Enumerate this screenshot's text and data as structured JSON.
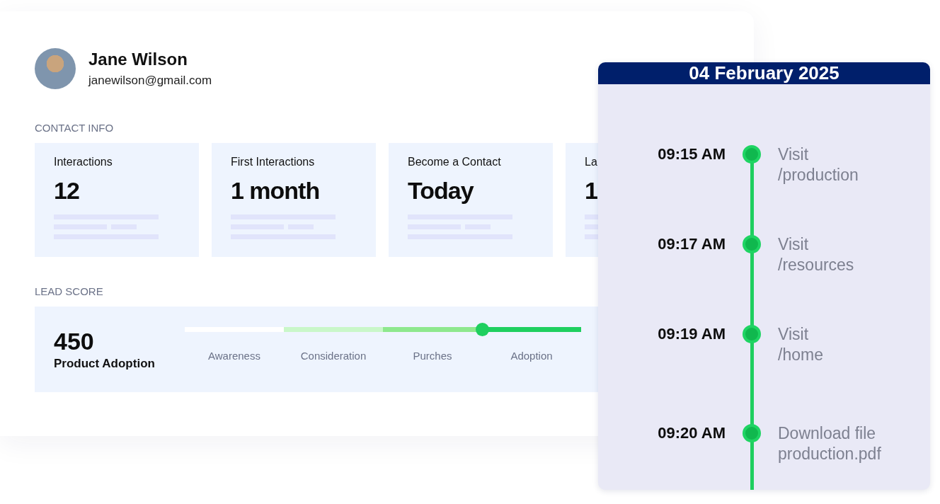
{
  "profile": {
    "name": "Jane Wilson",
    "email": "janewilson@gmail.com"
  },
  "contact_info": {
    "heading": "CONTACT INFO",
    "cards": [
      {
        "label": "Interactions",
        "value": "12"
      },
      {
        "label": "First Interactions",
        "value": "1 month"
      },
      {
        "label": "Become a Contact",
        "value": "Today"
      },
      {
        "label": "La",
        "value": "1"
      }
    ]
  },
  "lead_score": {
    "heading": "LEAD SCORE",
    "score": "450",
    "stage_name": "Product Adoption",
    "stages": [
      {
        "label": "Awareness",
        "color": "#ffffff",
        "selected": false
      },
      {
        "label": "Consideration",
        "color": "#c9f7c9",
        "selected": false
      },
      {
        "label": "Purches",
        "color": "#8ee88e",
        "selected": false
      },
      {
        "label": "Adoption",
        "color": "#1fcf5f",
        "selected": true
      }
    ]
  },
  "timeline": {
    "date": "04 February 2025",
    "events": [
      {
        "time": "09:15 AM",
        "action": "Visit",
        "target": "/production"
      },
      {
        "time": "09:17 AM",
        "action": "Visit",
        "target": "/resources"
      },
      {
        "time": "09:19 AM",
        "action": "Visit",
        "target": "/home"
      },
      {
        "time": "09:20 AM",
        "action": "Download file",
        "target": "production.pdf"
      }
    ]
  }
}
